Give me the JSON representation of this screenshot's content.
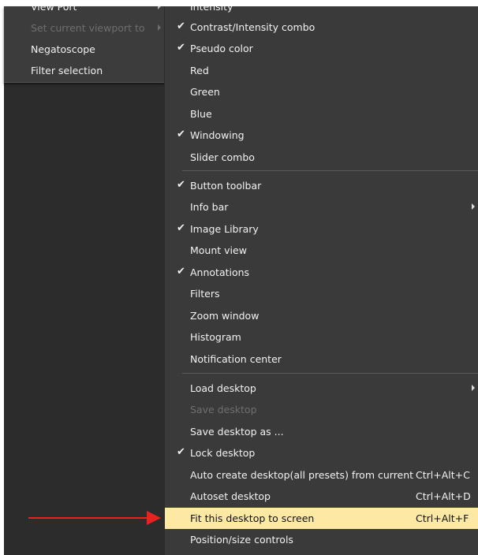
{
  "left_menu": {
    "items": [
      {
        "label": "View Port",
        "submenu": true,
        "disabled": false
      },
      {
        "label": "Set current viewport to",
        "submenu": true,
        "disabled": true
      },
      {
        "label": "Negatoscope",
        "submenu": false,
        "disabled": false
      },
      {
        "label": "Filter selection",
        "submenu": false,
        "disabled": false
      }
    ]
  },
  "main_menu": {
    "items": [
      {
        "label": "Intensity",
        "checked": false,
        "disabled": false
      },
      {
        "label": "Contrast/Intensity combo",
        "checked": true,
        "disabled": false
      },
      {
        "label": "Pseudo color",
        "checked": true,
        "disabled": false
      },
      {
        "label": "Red",
        "checked": false,
        "disabled": false
      },
      {
        "label": "Green",
        "checked": false,
        "disabled": false
      },
      {
        "label": "Blue",
        "checked": false,
        "disabled": false
      },
      {
        "label": "Windowing",
        "checked": true,
        "disabled": false
      },
      {
        "label": "Slider combo",
        "checked": false,
        "disabled": false
      },
      {
        "label": "Button toolbar",
        "checked": true,
        "disabled": false
      },
      {
        "label": "Info bar",
        "checked": false,
        "disabled": false,
        "submenu": true
      },
      {
        "label": "Image Library",
        "checked": true,
        "disabled": false
      },
      {
        "label": "Mount view",
        "checked": false,
        "disabled": false
      },
      {
        "label": "Annotations",
        "checked": true,
        "disabled": false
      },
      {
        "label": "Filters",
        "checked": false,
        "disabled": false
      },
      {
        "label": "Zoom window",
        "checked": false,
        "disabled": false
      },
      {
        "label": "Histogram",
        "checked": false,
        "disabled": false
      },
      {
        "label": "Notification center",
        "checked": false,
        "disabled": false
      },
      {
        "label": "Load desktop",
        "checked": false,
        "disabled": false,
        "submenu": true
      },
      {
        "label": "Save desktop",
        "checked": false,
        "disabled": true
      },
      {
        "label": "Save desktop as ...",
        "checked": false,
        "disabled": false
      },
      {
        "label": "Lock desktop",
        "checked": true,
        "disabled": false
      },
      {
        "label": "Auto create desktop(all presets) from current",
        "checked": false,
        "disabled": false,
        "shortcut": "Ctrl+Alt+C"
      },
      {
        "label": "Autoset desktop",
        "checked": false,
        "disabled": false,
        "shortcut": "Ctrl+Alt+D"
      },
      {
        "label": "Fit this desktop to screen",
        "checked": false,
        "disabled": false,
        "shortcut": "Ctrl+Alt+F",
        "highlighted": true
      },
      {
        "label": "Position/size controls",
        "checked": false,
        "disabled": false
      }
    ],
    "check_glyph": "✔"
  },
  "annotation": {
    "arrow_color": "#e8231f"
  },
  "colors": {
    "menu_bg": "#3a3a3a",
    "highlight_bg": "#fde8a4",
    "disabled_text": "#6e6e6e"
  }
}
